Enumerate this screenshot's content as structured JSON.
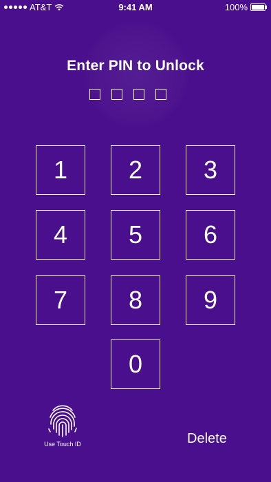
{
  "status_bar": {
    "carrier": "AT&T",
    "time": "9:41 AM",
    "battery": "100%"
  },
  "lock_screen": {
    "title": "Enter PIN to Unlock",
    "pin_length": 4,
    "keys": [
      "1",
      "2",
      "3",
      "4",
      "5",
      "6",
      "7",
      "8",
      "9",
      "0"
    ],
    "touch_id_label": "Use Touch ID",
    "delete_label": "Delete"
  },
  "colors": {
    "background": "#4a0f8c",
    "foreground": "#ffffff"
  }
}
